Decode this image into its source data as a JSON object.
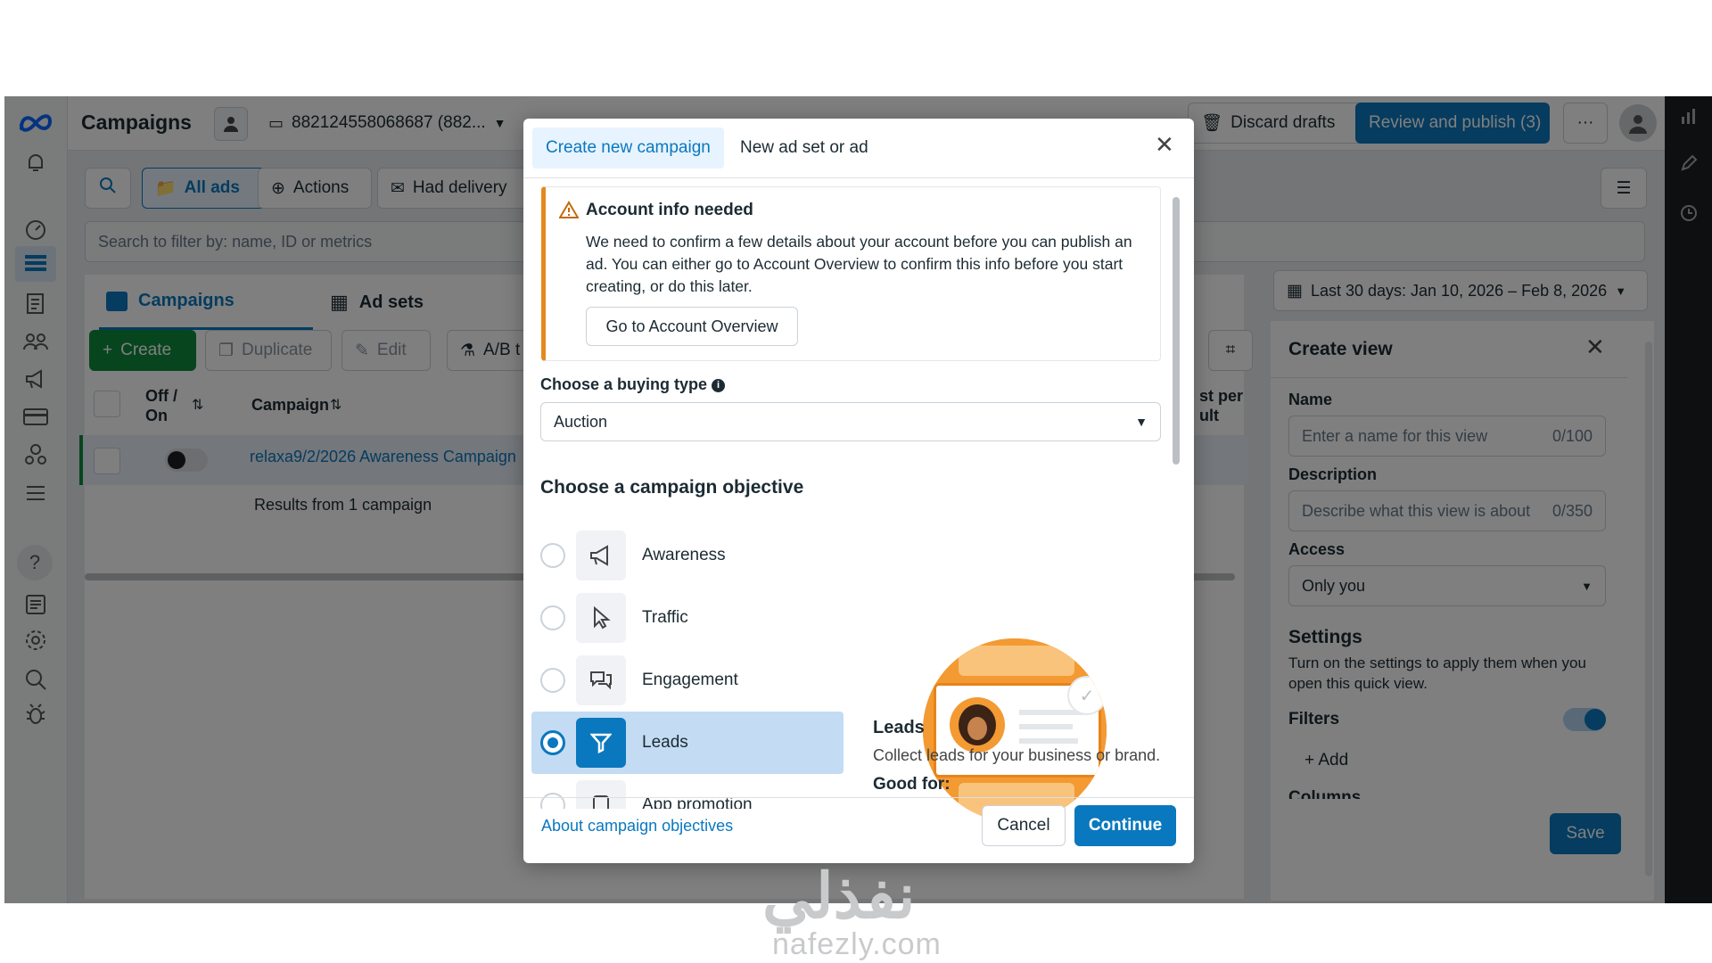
{
  "topbar": {
    "title": "Campaigns",
    "account": "882124558068687 (882...",
    "discard_drafts": "Discard drafts",
    "review_publish": "Review and publish (3)",
    "more": "···"
  },
  "filters": {
    "all_ads": "All ads",
    "actions": "Actions",
    "had_delivery": "Had delivery",
    "search_placeholder": "Search to filter by: name, ID or metrics"
  },
  "level_tabs": {
    "campaigns": "Campaigns",
    "ad_sets": "Ad sets"
  },
  "toolbar": {
    "create": "Create",
    "duplicate": "Duplicate",
    "edit": "Edit",
    "ab_test": "A/B t"
  },
  "table": {
    "col_offon": "Off /\nOn",
    "col_campaign": "Campaign",
    "col_cost_partial": "st per\nult",
    "row_campaign": "relaxa9/2/2026 Awareness Campaign",
    "results_summary": "Results from 1 campaign"
  },
  "date_range": "Last 30 days: Jan 10, 2026 – Feb 8, 2026",
  "create_view": {
    "title": "Create view",
    "name_label": "Name",
    "name_placeholder": "Enter a name for this view",
    "name_count": "0/100",
    "desc_label": "Description",
    "desc_placeholder": "Describe what this view is about",
    "desc_count": "0/350",
    "access_label": "Access",
    "access_value": "Only you",
    "settings_title": "Settings",
    "settings_text": "Turn on the settings to apply them when you open this quick view.",
    "filters_label": "Filters",
    "add_label": "Add",
    "columns_partial": "Columns",
    "save": "Save"
  },
  "modal": {
    "tab_create": "Create new campaign",
    "tab_new_adset": "New ad set or ad",
    "alert_title": "Account info needed",
    "alert_body": "We need to confirm a few details about your account before you can publish an ad. You can either go to Account Overview to confirm this info before you start creating, or do this later.",
    "alert_button": "Go to Account Overview",
    "buying_type_label": "Choose a buying type",
    "buying_type_value": "Auction",
    "objective_heading": "Choose a campaign objective",
    "objectives": [
      {
        "label": "Awareness",
        "icon": "megaphone-icon",
        "selected": false
      },
      {
        "label": "Traffic",
        "icon": "cursor-icon",
        "selected": false
      },
      {
        "label": "Engagement",
        "icon": "chat-bubbles-icon",
        "selected": false
      },
      {
        "label": "Leads",
        "icon": "funnel-icon",
        "selected": true
      },
      {
        "label": "App promotion",
        "icon": "app-icon",
        "selected": false
      }
    ],
    "detail_title": "Leads",
    "detail_desc": "Collect leads for your business or brand.",
    "good_for": "Good for:",
    "about_link": "About campaign objectives",
    "cancel": "Cancel",
    "continue": "Continue"
  },
  "watermark": {
    "arabic": "نفذلي",
    "latin": "nafezly.com"
  },
  "colors": {
    "primary": "#0a78be",
    "create_green": "#0e8a3e",
    "warning": "#e38a1e",
    "selected_bg": "#c3dcf3"
  }
}
